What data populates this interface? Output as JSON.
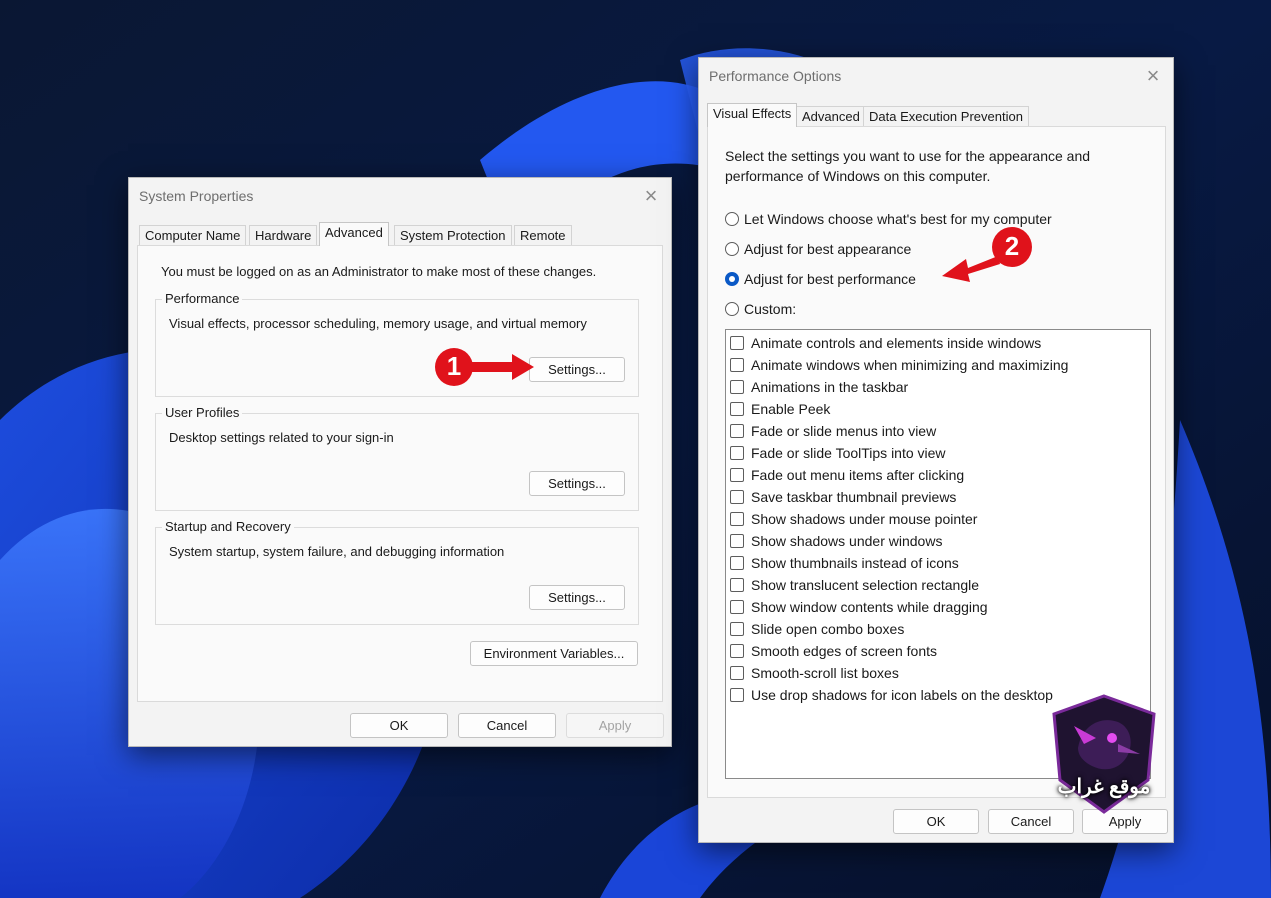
{
  "system_properties": {
    "title": "System Properties",
    "close_glyph": "×",
    "tabs": [
      {
        "label": "Computer Name"
      },
      {
        "label": "Hardware"
      },
      {
        "label": "Advanced"
      },
      {
        "label": "System Protection"
      },
      {
        "label": "Remote"
      }
    ],
    "active_tab": "Advanced",
    "admin_note": "You must be logged on as an Administrator to make most of these changes.",
    "groups": [
      {
        "label": "Performance",
        "description": "Visual effects, processor scheduling, memory usage, and virtual memory",
        "button": "Settings..."
      },
      {
        "label": "User Profiles",
        "description": "Desktop settings related to your sign-in",
        "button": "Settings..."
      },
      {
        "label": "Startup and Recovery",
        "description": "System startup, system failure, and debugging information",
        "button": "Settings..."
      }
    ],
    "env_button": "Environment Variables...",
    "footer": {
      "ok": "OK",
      "cancel": "Cancel",
      "apply": "Apply"
    }
  },
  "performance_options": {
    "title": "Performance Options",
    "close_glyph": "×",
    "tabs": [
      {
        "label": "Visual Effects"
      },
      {
        "label": "Advanced"
      },
      {
        "label": "Data Execution Prevention"
      }
    ],
    "active_tab": "Visual Effects",
    "intro_line1": "Select the settings you want to use for the appearance and",
    "intro_line2": "performance of Windows on this computer.",
    "radios": [
      {
        "label": "Let Windows choose what's best for my computer",
        "checked": false
      },
      {
        "label": "Adjust for best appearance",
        "checked": false
      },
      {
        "label": "Adjust for best performance",
        "checked": true
      },
      {
        "label": "Custom:",
        "checked": false
      }
    ],
    "effects": [
      "Animate controls and elements inside windows",
      "Animate windows when minimizing and maximizing",
      "Animations in the taskbar",
      "Enable Peek",
      "Fade or slide menus into view",
      "Fade or slide ToolTips into view",
      "Fade out menu items after clicking",
      "Save taskbar thumbnail previews",
      "Show shadows under mouse pointer",
      "Show shadows under windows",
      "Show thumbnails instead of icons",
      "Show translucent selection rectangle",
      "Show window contents while dragging",
      "Slide open combo boxes",
      "Smooth edges of screen fonts",
      "Smooth-scroll list boxes",
      "Use drop shadows for icon labels on the desktop"
    ],
    "footer": {
      "ok": "OK",
      "cancel": "Cancel",
      "apply": "Apply"
    }
  },
  "annotations": {
    "step1": "1",
    "step2": "2",
    "marker_color": "#e0121b"
  },
  "watermark": {
    "text": "موقع غراب",
    "icon": "crow-shield-logo"
  },
  "colors": {
    "accent": "#0b59c6",
    "wallpaper_dark": "#07142e",
    "wallpaper_blue": "#1f5fff"
  }
}
